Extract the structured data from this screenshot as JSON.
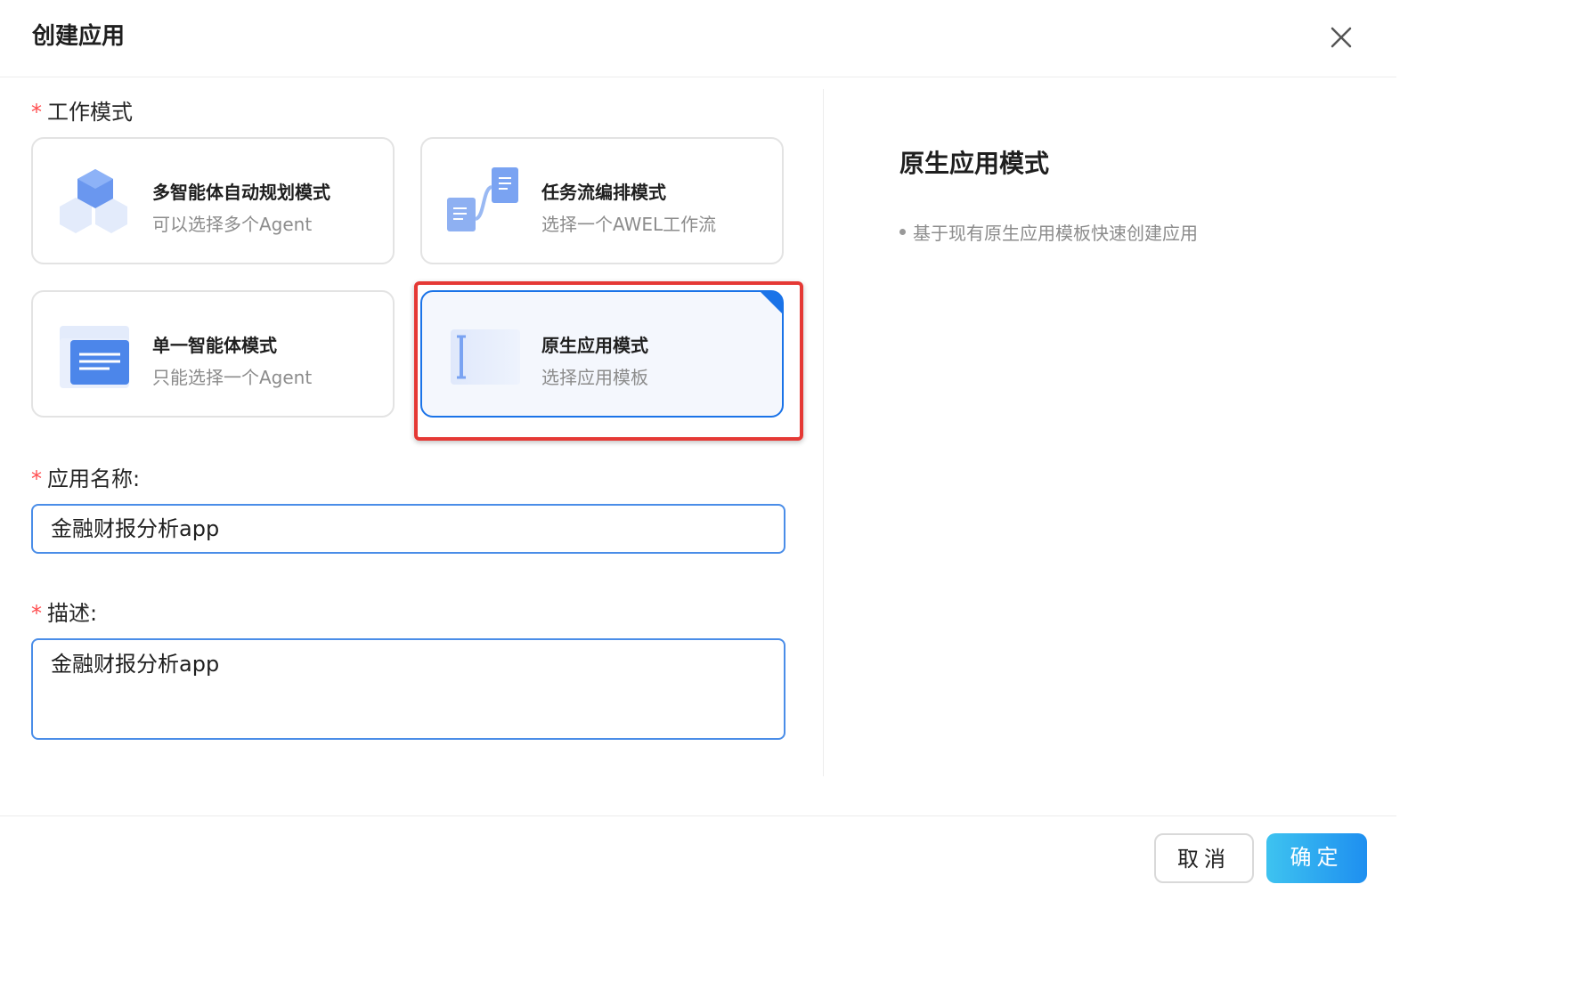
{
  "dialog": {
    "title": "创建应用",
    "close_icon": "close-icon"
  },
  "form": {
    "mode_label": "工作模式",
    "required_mark": "*",
    "modes": [
      {
        "title": "多智能体自动规划模式",
        "subtitle": "可以选择多个Agent",
        "icon": "hexagon-cubes-icon",
        "selected": false
      },
      {
        "title": "任务流编排模式",
        "subtitle": "选择一个AWEL工作流",
        "icon": "workflow-icon",
        "selected": false
      },
      {
        "title": "单一智能体模式",
        "subtitle": "只能选择一个Agent",
        "icon": "document-card-icon",
        "selected": false
      },
      {
        "title": "原生应用模式",
        "subtitle": "选择应用模板",
        "icon": "template-icon",
        "selected": true
      }
    ],
    "name_label": "应用名称:",
    "name_value": "金融财报分析app",
    "desc_label": "描述:",
    "desc_value": "金融财报分析app"
  },
  "side_panel": {
    "title": "原生应用模式",
    "bullets": [
      "基于现有原生应用模板快速创建应用"
    ]
  },
  "footer": {
    "cancel_label": "取消",
    "ok_label": "确定"
  },
  "colors": {
    "accent": "#1a73e8",
    "required": "#ff4d4f",
    "highlight_box": "#e53935",
    "ok_gradient_start": "#3ec3f0",
    "ok_gradient_end": "#1e8ff0"
  }
}
